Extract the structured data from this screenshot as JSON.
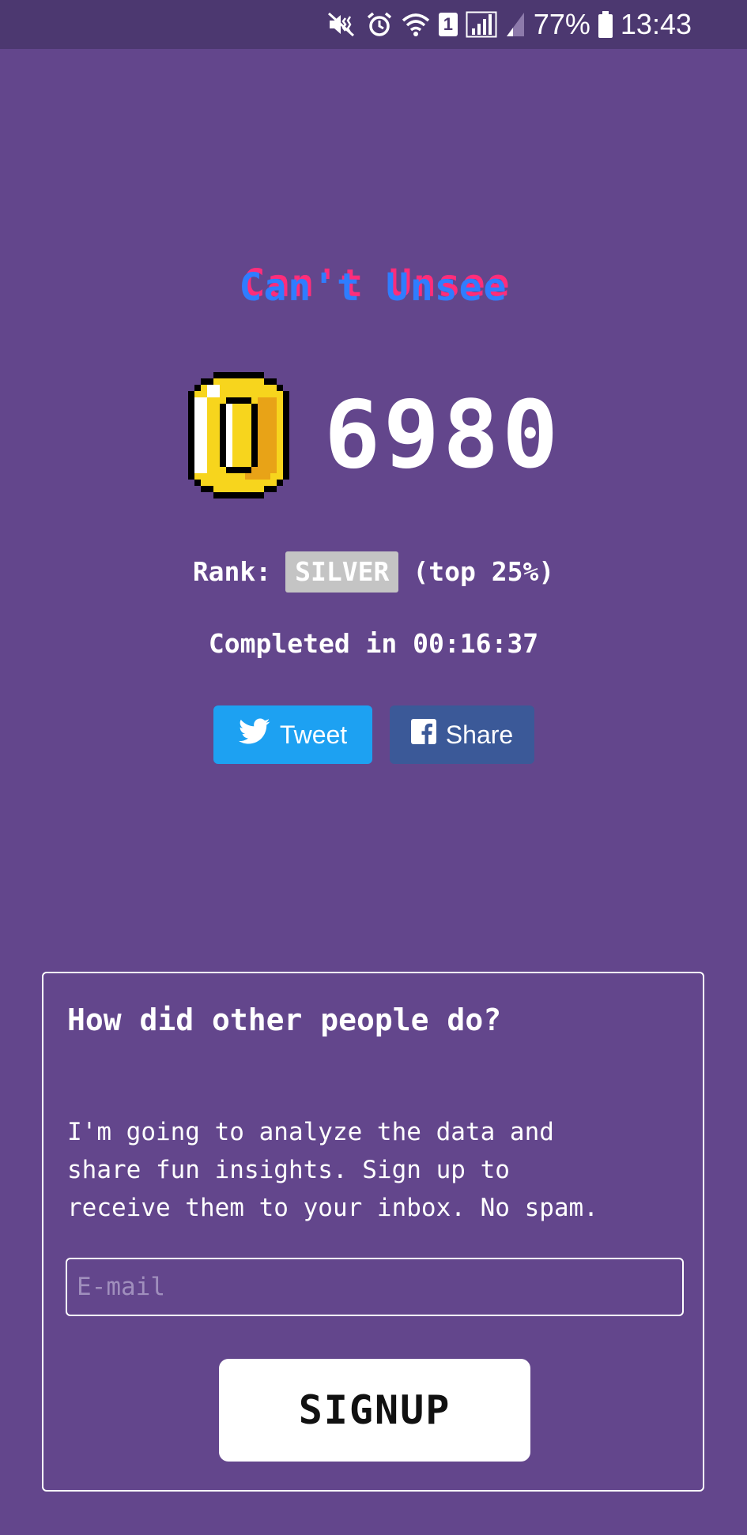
{
  "status_bar": {
    "battery_percent": "77%",
    "time": "13:43",
    "sim_slot": "1",
    "icons": [
      "mute-vibrate-icon",
      "alarm-icon",
      "wifi-icon",
      "sim-icon",
      "signal-icon",
      "signal-weak-icon",
      "battery-icon"
    ]
  },
  "game": {
    "title": "Can't Unsee",
    "score": "6980",
    "coin_icon": "coin-icon",
    "rank_label": "Rank:",
    "rank": "SILVER",
    "rank_percentile": "(top 25%)",
    "completed": "Completed in 00:16:37"
  },
  "share": {
    "tweet_label": "Tweet",
    "share_label": "Share",
    "tweet_color": "#1da1f2",
    "share_color": "#3b5998"
  },
  "signup": {
    "heading": "How did other people do?",
    "description": "I'm going to analyze the data and\nshare fun insights. Sign up to\nreceive them to your inbox. No spam.",
    "email_placeholder": "E-mail",
    "email_value": "",
    "button_label": "SIGNUP"
  },
  "colors": {
    "background": "#63468c",
    "status_bar": "#4c3870",
    "title_blue": "#2f7dff",
    "title_pink": "#ff2d7a",
    "rank_badge": "#c4c4c4"
  }
}
